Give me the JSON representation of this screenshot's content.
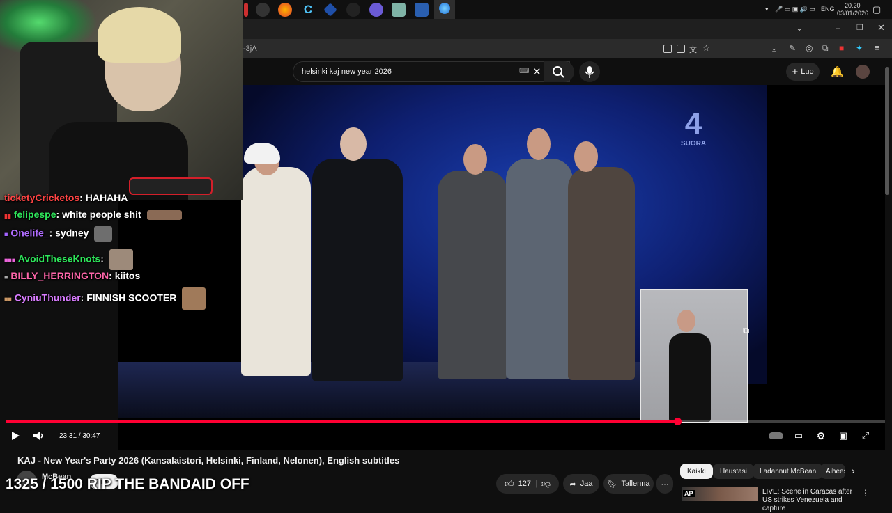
{
  "taskbar": {
    "time": "20.20",
    "date": "03/01/2026",
    "language": "ENG"
  },
  "browser": {
    "url_fragment": "-3jA"
  },
  "youtube": {
    "search_query": "helsinki kaj new year 2026",
    "create_label": "Luo"
  },
  "video": {
    "channel_logo_number": "4",
    "channel_logo_text": "SUORA",
    "current_time": "23:31",
    "duration": "30:47",
    "time_display": "23:31 / 30:47",
    "progress": 0.7635
  },
  "stream_overlay": {
    "chat": [
      {
        "user": "ticketyCricketos",
        "message": "HAHAHA",
        "color": "#ff4444"
      },
      {
        "user": "felipespe",
        "message": "white people shit",
        "color": "#2ee65a"
      },
      {
        "user": "Onelife_",
        "message": "sydney",
        "color": "#b06cff"
      },
      {
        "user": "AvoidTheseKnots",
        "message": "",
        "color": "#2ee65a"
      },
      {
        "user": "BILLY_HERRINGTON",
        "message": "kiitos",
        "color": "#ff66aa"
      },
      {
        "user": "CyniuThunder",
        "message": "FINNISH SCOOTER",
        "color": "#d97cff"
      }
    ],
    "goal_text": "1325 / 1500 RIP THE BANDAID OFF"
  },
  "watch": {
    "title": "KAJ - New Year's Party 2026 (Kansalaistori, Helsinki, Finland, Nelonen), English subtitles",
    "channel_name": "McBean",
    "subscribe_label": "Tilaa",
    "like_count": "127",
    "share_label": "Jaa",
    "save_label": "Tallenna"
  },
  "chips": [
    "Kaikki",
    "Haustasi",
    "Ladannut McBean",
    "Aiheeseen"
  ],
  "recommendation": {
    "title": "LIVE: Scene in Caracas after US strikes Venezuela and capture",
    "badge": "AP"
  },
  "colors": {
    "progress": "#ff0033",
    "background": "#0f0f0f"
  }
}
